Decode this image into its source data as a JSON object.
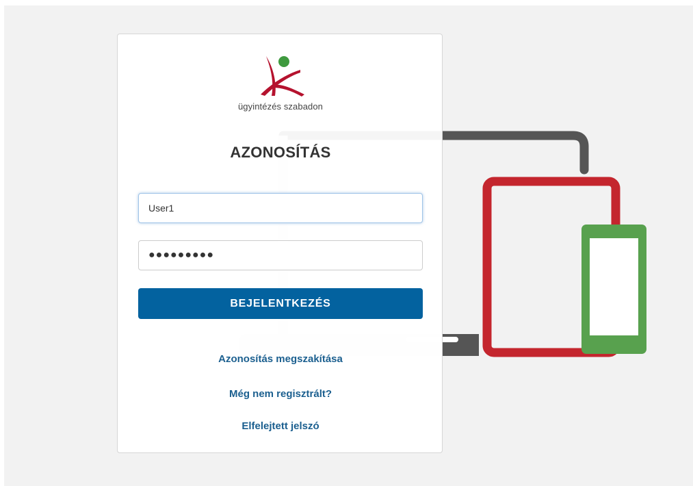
{
  "brand": {
    "tagline": "ügyintézés szabadon",
    "colors": {
      "red": "#b5122e",
      "green": "#3f9a3f",
      "primary": "#03629f"
    }
  },
  "login": {
    "title": "AZONOSÍTÁS",
    "username": {
      "value": "User1"
    },
    "password": {
      "value": "●●●●●●●●●"
    },
    "submit_label": "BEJELENTKEZÉS"
  },
  "links": {
    "cancel": "Azonosítás megszakítása",
    "register": "Még nem regisztrált?",
    "forgot": "Elfelejtett jelszó"
  },
  "illustration": {
    "icons": [
      "laptop-icon",
      "tablet-icon",
      "phone-icon"
    ],
    "colors": {
      "laptop": "#555555",
      "tablet": "#c4262e",
      "phone": "#58a14e"
    }
  }
}
